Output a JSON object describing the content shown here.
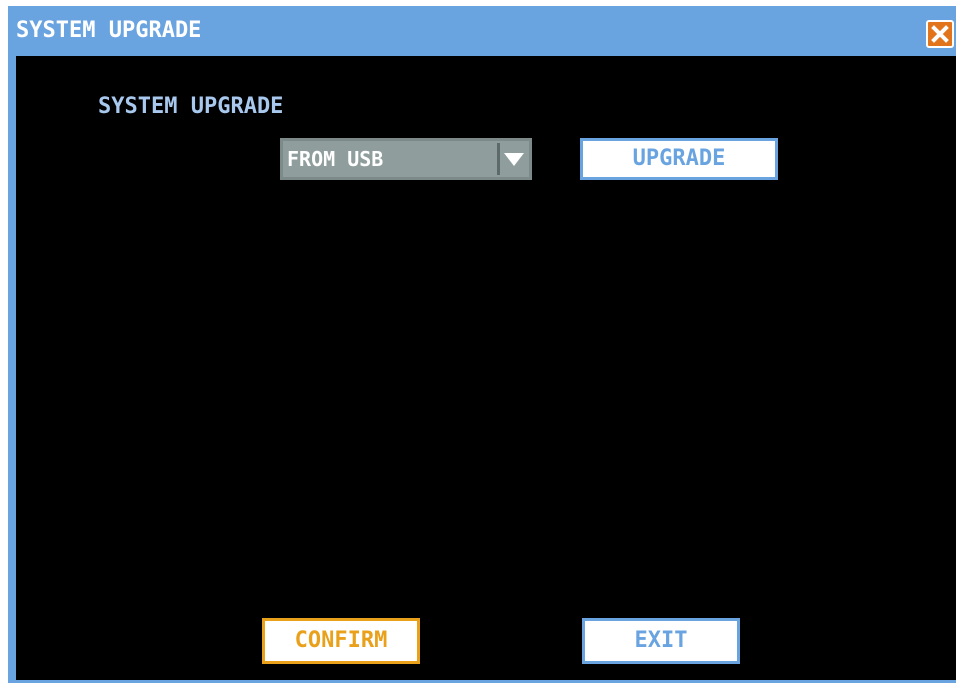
{
  "window": {
    "title": "SYSTEM UPGRADE"
  },
  "section": {
    "label": "SYSTEM UPGRADE"
  },
  "source_select": {
    "value": "FROM USB"
  },
  "buttons": {
    "upgrade": "UPGRADE",
    "confirm": "CONFIRM",
    "exit": "EXIT"
  },
  "colors": {
    "titlebar": "#6aa4e0",
    "background": "#000000",
    "accent_blue": "#6aa4e0",
    "confirm_orange": "#e9a11c",
    "close_orange": "#e2741c"
  },
  "icons": {
    "close": "close-x-icon",
    "dropdown": "dropdown-arrow-icon"
  }
}
